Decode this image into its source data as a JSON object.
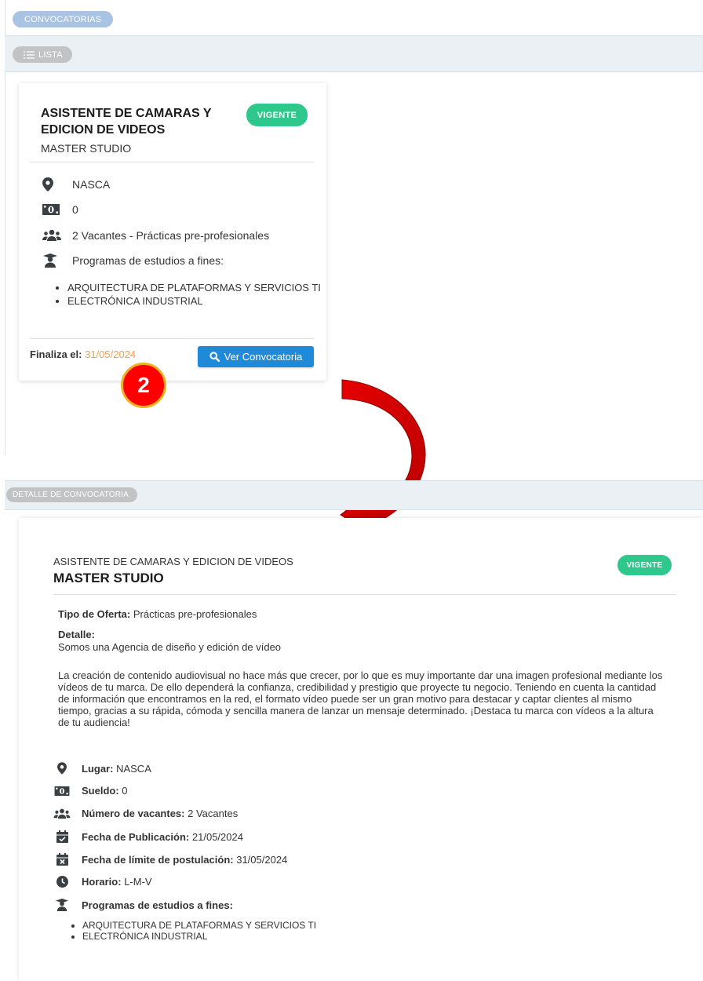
{
  "header": {
    "section_label": "CONVOCATORIAS",
    "list_button_label": "LISTA"
  },
  "card": {
    "title": "ASISTENTE DE CAMARAS Y EDICION DE VIDEOS",
    "company": "MASTER STUDIO",
    "status": "VIGENTE",
    "location": "NASCA",
    "salary": "0",
    "vacancies": "2 Vacantes - Prácticas pre-profesionales",
    "programs_label": "Programas de estudios a fines:",
    "programs": [
      "ARQUITECTURA DE PLATAFORMAS Y SERVICIOS TI",
      "ELECTRÓNICA INDUSTRIAL"
    ],
    "end_label": "Finaliza el:",
    "end_date": "31/05/2024",
    "view_button": "Ver Convocatoria"
  },
  "step_number": "2",
  "detail": {
    "section_label": "DETALLE DE CONVOCATORIA",
    "title": "ASISTENTE DE CAMARAS Y EDICION DE VIDEOS",
    "company": "MASTER STUDIO",
    "status": "VIGENTE",
    "offer_type_label": "Tipo de Oferta:",
    "offer_type": "Prácticas pre-profesionales",
    "detail_label": "Detalle:",
    "detail_line1": "Somos una Agencia de diseño y edición de vídeo",
    "detail_paragraph": "La creación de contenido audiovisual no hace más que crecer, por lo que es muy importante dar una imagen profesional mediante los vídeos de tu marca. De ello dependerá la confianza, credibilidad y prestigio que proyecte tu negocio. Teniendo en cuenta la cantidad de información que encontramos en la red, el formato vídeo puede ser un gran motivo para destacar y captar clientes al mismo tiempo, gracias a su rápida, cómoda y sencilla manera de lanzar un mensaje determinado. ¡Destaca tu marca con vídeos a la altura de tu audiencia!",
    "place_label": "Lugar:",
    "place": "NASCA",
    "salary_label": "Sueldo:",
    "salary": "0",
    "vacancies_label": "Número de vacantes:",
    "vacancies": "2 Vacantes",
    "published_label": "Fecha de Publicación:",
    "published": "21/05/2024",
    "deadline_label": "Fecha de límite de postulación:",
    "deadline": "31/05/2024",
    "schedule_label": "Horario:",
    "schedule": "L-M-V",
    "programs_label": "Programas de estudios a fines:",
    "programs": [
      "ARQUITECTURA DE PLATAFORMAS Y SERVICIOS TI",
      "ELECTRÓNICA INDUSTRIAL"
    ]
  },
  "colors": {
    "status_green": "#2ec88c",
    "primary_blue": "#1f8bd8",
    "date_orange": "#f0a052",
    "annotation_red": "#ff0000"
  },
  "icons": [
    "map-marker-icon",
    "money-bill-icon",
    "users-icon",
    "graduate-icon",
    "search-icon",
    "calendar-check-icon",
    "calendar-x-icon",
    "clock-icon",
    "list-icon",
    "curved-arrow-icon"
  ]
}
